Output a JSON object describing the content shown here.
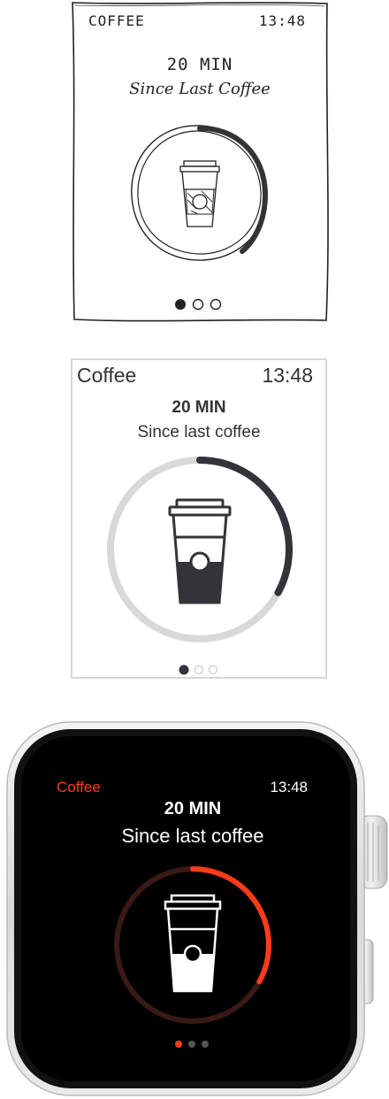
{
  "sketch": {
    "app_title": "COFFEE",
    "time": "13:48",
    "elapsed": "20 MIN",
    "subtitle": "Since Last Coffee",
    "progress_fraction": 0.33,
    "page_count": 3,
    "active_page": 1
  },
  "wireframe": {
    "app_title": "Coffee",
    "time": "13:48",
    "elapsed": "20 MIN",
    "subtitle": "Since last coffee",
    "progress_fraction": 0.33,
    "page_count": 3,
    "active_page": 1
  },
  "watch": {
    "app_title": "Coffee",
    "time": "13:48",
    "elapsed": "20 MIN",
    "subtitle": "Since last coffee",
    "progress_fraction": 0.33,
    "page_count": 3,
    "active_page": 1,
    "accent_color": "#ff3b1a",
    "ring_track_color": "#3a1a15",
    "screen_color": "#000000"
  },
  "colors": {
    "wireframe_ring_track": "#d8d8d8",
    "wireframe_ring_progress": "#333339",
    "wireframe_border": "#d7d7d7"
  }
}
